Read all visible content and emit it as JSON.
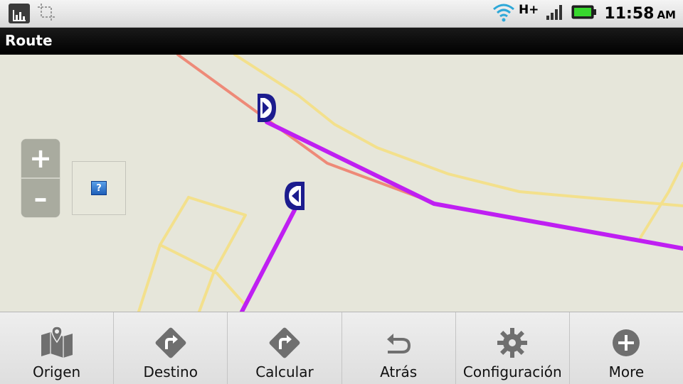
{
  "status_bar": {
    "network_type": "H+",
    "time": "11:58",
    "ampm": "AM",
    "icons": [
      "app-chart-icon",
      "crop-icon",
      "wifi-icon",
      "signal-icon",
      "battery-icon"
    ]
  },
  "title_bar": {
    "title": "Route"
  },
  "map": {
    "zoom_in_label": "+",
    "zoom_out_label": "–",
    "help_label": "?",
    "colors": {
      "route": "#bf1ff2",
      "primary_road": "#ee8a78",
      "minor_road": "#f3e08c",
      "marker": "#1c1c8e",
      "background": "#e6e6da"
    }
  },
  "menu": {
    "items": [
      {
        "label": "Origen",
        "icon": "map-pin-icon"
      },
      {
        "label": "Destino",
        "icon": "turn-right-diamond-icon"
      },
      {
        "label": "Calcular",
        "icon": "turn-right-diamond-icon"
      },
      {
        "label": "Atrás",
        "icon": "undo-arrow-icon"
      },
      {
        "label": "Configuración",
        "icon": "gear-icon"
      },
      {
        "label": "More",
        "icon": "plus-circle-icon"
      }
    ]
  }
}
